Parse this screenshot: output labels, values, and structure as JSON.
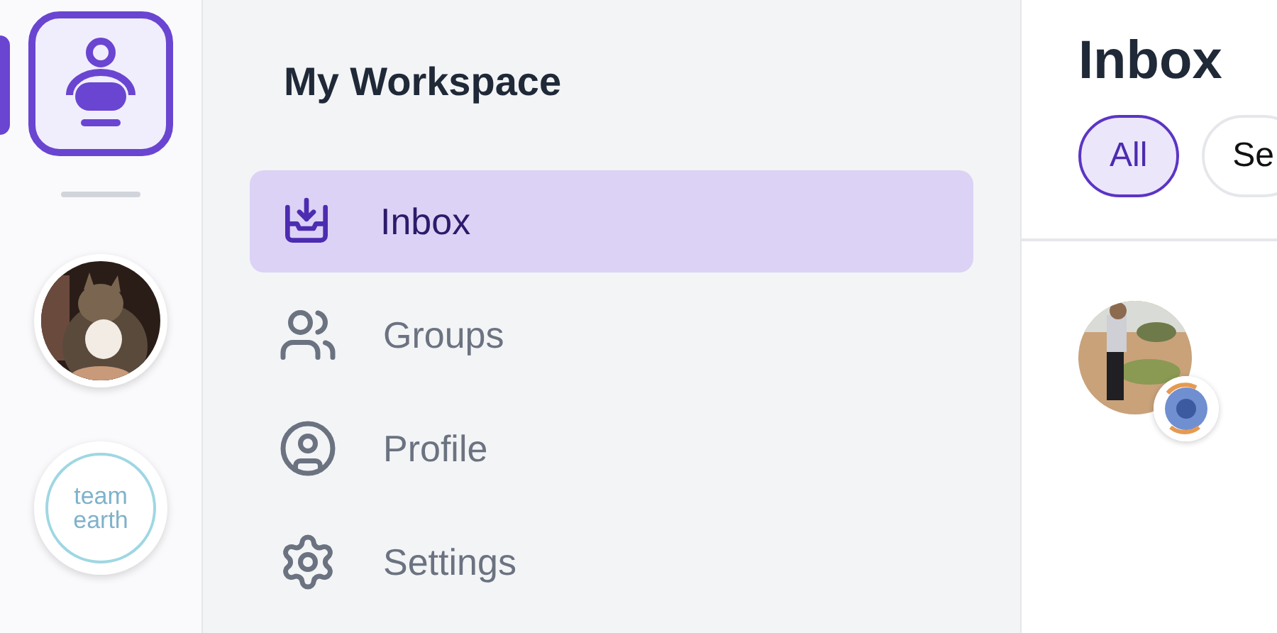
{
  "rail": {
    "workspaces": [
      {
        "kind": "icon",
        "selected": true
      },
      {
        "kind": "picture",
        "selected": false
      },
      {
        "kind": "logo",
        "text": "team earth",
        "selected": false
      }
    ]
  },
  "sidebar": {
    "title": "My Workspace",
    "items": [
      {
        "label": "Inbox",
        "kind": "inbox",
        "selected": true
      },
      {
        "label": "Groups",
        "kind": "groups",
        "selected": false
      },
      {
        "label": "Profile",
        "kind": "profile",
        "selected": false
      },
      {
        "label": "Settings",
        "kind": "settings",
        "selected": false
      }
    ]
  },
  "main": {
    "title": "Inbox",
    "filters": [
      {
        "label": "All",
        "selected": true
      },
      {
        "label": "Se",
        "selected": false
      }
    ],
    "messages": [
      {
        "kind": "picture"
      }
    ]
  }
}
